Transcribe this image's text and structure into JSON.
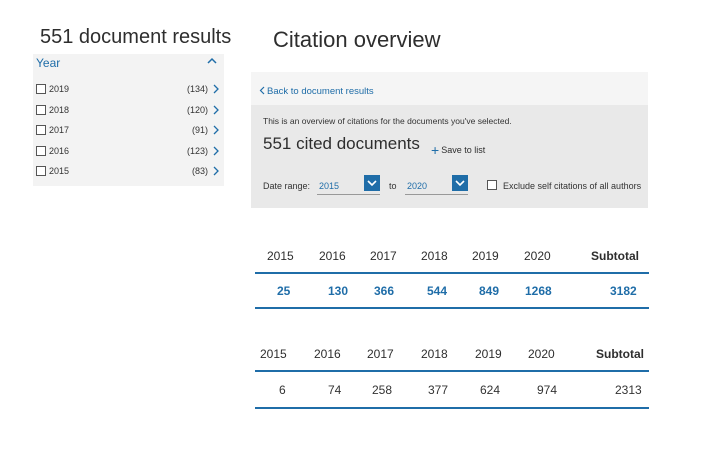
{
  "facet": {
    "results_title": "551 document results",
    "header": "Year",
    "rows": [
      {
        "label": "2019",
        "count": "(134)"
      },
      {
        "label": "2018",
        "count": "(120)"
      },
      {
        "label": "2017",
        "count": "(91)"
      },
      {
        "label": "2016",
        "count": "(123)"
      },
      {
        "label": "2015",
        "count": "(83)"
      }
    ]
  },
  "overview": {
    "title": "Citation overview",
    "back_link": "Back to document results",
    "intro": "This is an overview of citations for the documents you've selected.",
    "cited_title": "551 cited documents",
    "save_label": "Save to list",
    "date_range_label": "Date range:",
    "from_value": "2015",
    "to_label": "to",
    "to_value": "2020",
    "exclude_label": "Exclude self citations of all authors"
  },
  "tables": [
    {
      "headers": [
        "2015",
        "2016",
        "2017",
        "2018",
        "2019",
        "2020",
        "Subtotal"
      ],
      "values": [
        "25",
        "130",
        "366",
        "544",
        "849",
        "1268",
        "3182"
      ]
    },
    {
      "headers": [
        "2015",
        "2016",
        "2017",
        "2018",
        "2019",
        "2020",
        "Subtotal"
      ],
      "values": [
        "6",
        "74",
        "258",
        "377",
        "624",
        "974",
        "2313"
      ]
    }
  ],
  "colors": {
    "accent": "#1f6da8",
    "panel": "#e9e9e9"
  }
}
